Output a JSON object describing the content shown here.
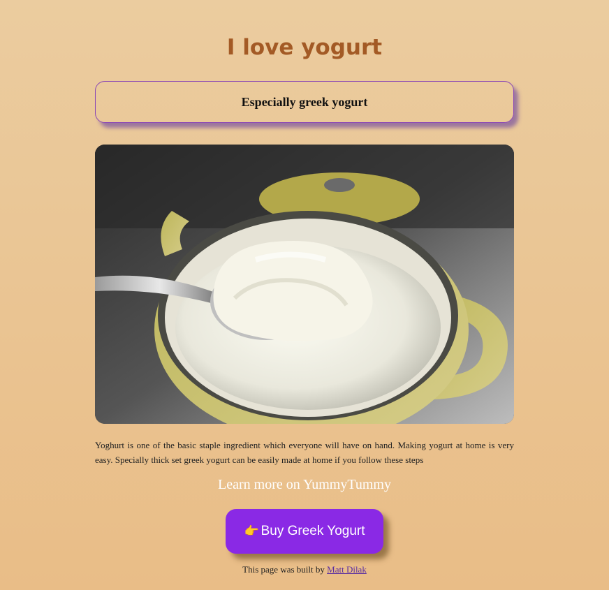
{
  "heading": "I love yogurt",
  "subtitle": "Especially greek yogurt",
  "image": {
    "alt": "greek yogurt on a spoon over a pot"
  },
  "description": "Yoghurt is one of the basic staple ingredient which everyone will have on hand. Making yogurt at home is very easy. Specially thick set greek yogurt can be easily made at home if you follow these steps",
  "learn_more": "Learn more on YummyTummy",
  "buy_button": {
    "icon": "👉",
    "label": "Buy Greek Yogurt"
  },
  "footer": {
    "prefix": "This page was built by ",
    "author": "Matt Dilak"
  },
  "colors": {
    "heading": "#a35a25",
    "button": "#8a29e5",
    "border": "#8a47b5"
  }
}
